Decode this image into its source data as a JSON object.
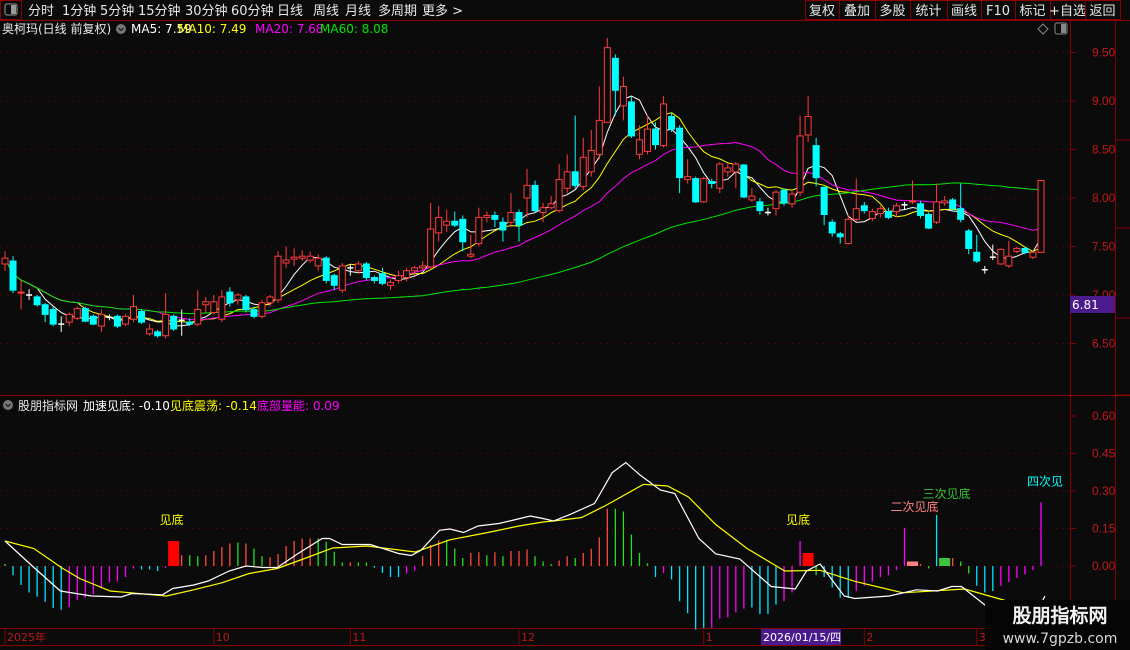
{
  "toolbar": {
    "periods": [
      "分时",
      "1分钟",
      "5分钟",
      "15分钟",
      "30分钟",
      "60分钟",
      "日线",
      "周线",
      "月线",
      "多周期",
      "更多 >"
    ],
    "active_period": "日线",
    "buttons": [
      "复权",
      "叠加",
      "多股",
      "统计",
      "画线",
      "F10",
      "标记",
      "+自选",
      "返回"
    ]
  },
  "main_chart": {
    "title": "奥柯玛(日线 前复权)",
    "ma": [
      {
        "label": "MA5: 7.59",
        "color": "#ffffff"
      },
      {
        "label": "MA10: 7.49",
        "color": "#ffff00"
      },
      {
        "label": "MA20: 7.68",
        "color": "#ff00ff"
      },
      {
        "label": "MA60: 8.08",
        "color": "#00e600"
      }
    ],
    "y_ticks": [
      "9.50",
      "9.00",
      "8.50",
      "8.00",
      "7.50",
      "7.00",
      "6.50"
    ],
    "y_tick_values": [
      9.5,
      9.0,
      8.5,
      8.0,
      7.5,
      7.0,
      6.5
    ],
    "cursor_price": "6.81",
    "up_color": "#ff3c3c",
    "down_color": "#00ffff",
    "candles": [
      [
        7.32,
        7.38,
        7.45,
        7.25
      ],
      [
        7.35,
        7.05,
        7.4,
        7.02
      ],
      [
        7.02,
        7.03,
        7.15,
        6.85
      ],
      [
        7.0,
        7.0,
        7.06,
        6.95
      ],
      [
        6.98,
        6.9,
        7.0,
        6.88
      ],
      [
        6.9,
        6.8,
        6.92,
        6.72
      ],
      [
        6.85,
        6.7,
        6.88,
        6.68
      ],
      [
        6.7,
        6.7,
        6.78,
        6.62
      ],
      [
        6.72,
        6.8,
        6.82,
        6.68
      ],
      [
        6.76,
        6.86,
        6.88,
        6.74
      ],
      [
        6.86,
        6.73,
        6.88,
        6.72
      ],
      [
        6.78,
        6.7,
        6.8,
        6.69
      ],
      [
        6.68,
        6.8,
        6.85,
        6.62
      ],
      [
        6.77,
        6.77,
        6.8,
        6.74
      ],
      [
        6.78,
        6.68,
        6.8,
        6.66
      ],
      [
        6.7,
        6.78,
        6.8,
        6.68
      ],
      [
        6.75,
        6.88,
        7.0,
        6.72
      ],
      [
        6.83,
        6.72,
        6.85,
        6.7
      ],
      [
        6.6,
        6.65,
        6.7,
        6.58
      ],
      [
        6.62,
        6.58,
        6.64,
        6.56
      ],
      [
        6.58,
        6.8,
        7.02,
        6.55
      ],
      [
        6.78,
        6.65,
        6.8,
        6.63
      ],
      [
        6.74,
        6.74,
        6.85,
        6.58
      ],
      [
        6.72,
        6.7,
        6.76,
        6.68
      ],
      [
        6.7,
        6.85,
        7.05,
        6.68
      ],
      [
        6.9,
        6.93,
        6.98,
        6.82
      ],
      [
        6.82,
        6.93,
        7.0,
        6.8
      ],
      [
        6.75,
        6.98,
        7.05,
        6.72
      ],
      [
        7.03,
        6.92,
        7.08,
        6.88
      ],
      [
        6.95,
        7.0,
        7.02,
        6.9
      ],
      [
        6.98,
        6.85,
        7.0,
        6.82
      ],
      [
        6.85,
        6.78,
        6.88,
        6.76
      ],
      [
        6.78,
        6.92,
        6.95,
        6.76
      ],
      [
        6.92,
        6.98,
        7.0,
        6.88
      ],
      [
        6.95,
        7.4,
        7.45,
        6.92
      ],
      [
        7.33,
        7.36,
        7.5,
        7.28
      ],
      [
        7.37,
        7.39,
        7.48,
        7.3
      ],
      [
        7.38,
        7.4,
        7.46,
        7.35
      ],
      [
        7.36,
        7.4,
        7.45,
        7.33
      ],
      [
        7.3,
        7.38,
        7.42,
        7.25
      ],
      [
        7.38,
        7.15,
        7.4,
        7.12
      ],
      [
        7.2,
        7.1,
        7.22,
        7.05
      ],
      [
        7.05,
        7.3,
        7.33,
        7.02
      ],
      [
        7.28,
        7.28,
        7.32,
        7.2
      ],
      [
        7.25,
        7.32,
        7.35,
        7.22
      ],
      [
        7.32,
        7.18,
        7.34,
        7.15
      ],
      [
        7.18,
        7.15,
        7.2,
        7.12
      ],
      [
        7.22,
        7.12,
        7.28,
        7.1
      ],
      [
        7.1,
        7.13,
        7.16,
        7.05
      ],
      [
        7.15,
        7.2,
        7.25,
        7.12
      ],
      [
        7.18,
        7.25,
        7.28,
        7.14
      ],
      [
        7.25,
        7.28,
        7.3,
        7.2
      ],
      [
        7.28,
        7.3,
        7.35,
        7.26
      ],
      [
        7.29,
        7.68,
        7.95,
        7.27
      ],
      [
        7.64,
        7.8,
        7.92,
        7.55
      ],
      [
        7.72,
        7.76,
        7.88,
        7.65
      ],
      [
        7.76,
        7.72,
        7.86,
        7.7
      ],
      [
        7.78,
        7.55,
        7.82,
        7.45
      ],
      [
        7.4,
        7.42,
        7.62,
        7.38
      ],
      [
        7.53,
        7.8,
        7.9,
        7.5
      ],
      [
        7.8,
        7.82,
        7.86,
        7.75
      ],
      [
        7.82,
        7.78,
        7.86,
        7.7
      ],
      [
        7.75,
        7.67,
        7.8,
        7.55
      ],
      [
        7.75,
        7.85,
        8.05,
        7.7
      ],
      [
        7.85,
        7.72,
        7.88,
        7.55
      ],
      [
        8.0,
        8.13,
        8.3,
        7.8
      ],
      [
        8.13,
        7.87,
        8.18,
        7.85
      ],
      [
        7.85,
        7.9,
        7.95,
        7.75
      ],
      [
        7.9,
        7.94,
        8.02,
        7.88
      ],
      [
        7.87,
        8.19,
        8.35,
        7.85
      ],
      [
        8.1,
        8.27,
        8.45,
        8.05
      ],
      [
        8.27,
        8.13,
        8.85,
        8.1
      ],
      [
        8.12,
        8.42,
        8.62,
        8.08
      ],
      [
        8.27,
        8.49,
        8.7,
        8.22
      ],
      [
        8.45,
        8.8,
        9.15,
        8.4
      ],
      [
        8.78,
        9.55,
        9.65,
        8.78
      ],
      [
        9.44,
        9.11,
        9.48,
        8.85
      ],
      [
        8.95,
        9.15,
        9.25,
        8.8
      ],
      [
        8.99,
        8.64,
        9.05,
        8.62
      ],
      [
        8.45,
        8.6,
        8.75,
        8.4
      ],
      [
        8.48,
        8.71,
        8.85,
        8.45
      ],
      [
        8.71,
        8.55,
        8.78,
        8.5
      ],
      [
        8.54,
        8.97,
        9.05,
        8.52
      ],
      [
        8.84,
        8.71,
        8.88,
        8.68
      ],
      [
        8.72,
        8.21,
        8.75,
        8.05
      ],
      [
        8.19,
        8.22,
        8.4,
        8.15
      ],
      [
        8.2,
        7.96,
        8.22,
        7.95
      ],
      [
        7.96,
        8.2,
        8.22,
        7.95
      ],
      [
        8.17,
        8.15,
        8.2,
        8.1
      ],
      [
        8.1,
        8.35,
        8.37,
        8.05
      ],
      [
        8.27,
        8.31,
        8.36,
        8.22
      ],
      [
        8.27,
        8.35,
        8.37,
        8.1
      ],
      [
        8.34,
        8.01,
        8.35,
        8.0
      ],
      [
        7.98,
        8.02,
        8.1,
        7.96
      ],
      [
        7.96,
        7.87,
        8.0,
        7.83
      ],
      [
        7.85,
        7.85,
        7.9,
        7.82
      ],
      [
        7.89,
        8.06,
        8.08,
        7.82
      ],
      [
        8.08,
        7.95,
        8.1,
        7.92
      ],
      [
        7.94,
        8.04,
        8.07,
        7.9
      ],
      [
        8.06,
        8.64,
        8.85,
        8.02
      ],
      [
        8.65,
        8.84,
        9.05,
        8.58
      ],
      [
        8.54,
        8.21,
        8.62,
        8.12
      ],
      [
        8.11,
        7.83,
        8.12,
        7.72
      ],
      [
        7.75,
        7.64,
        7.78,
        7.6
      ],
      [
        7.63,
        7.6,
        7.65,
        7.53
      ],
      [
        7.53,
        7.78,
        7.83,
        7.52
      ],
      [
        7.78,
        7.89,
        8.2,
        7.76
      ],
      [
        7.92,
        7.87,
        7.96,
        7.84
      ],
      [
        7.79,
        7.86,
        7.89,
        7.76
      ],
      [
        7.84,
        7.89,
        7.92,
        7.8
      ],
      [
        7.86,
        7.8,
        7.9,
        7.78
      ],
      [
        7.86,
        7.92,
        7.95,
        7.8
      ],
      [
        7.93,
        7.93,
        7.96,
        7.88
      ],
      [
        7.96,
        7.97,
        8.18,
        7.94
      ],
      [
        7.94,
        7.82,
        7.97,
        7.79
      ],
      [
        7.83,
        7.69,
        7.85,
        7.68
      ],
      [
        7.75,
        7.96,
        8.15,
        7.73
      ],
      [
        7.95,
        7.97,
        8.02,
        7.92
      ],
      [
        7.98,
        7.89,
        8.0,
        7.86
      ],
      [
        7.89,
        7.78,
        8.15,
        7.75
      ],
      [
        7.66,
        7.48,
        7.68,
        7.42
      ],
      [
        7.44,
        7.35,
        7.62,
        7.33
      ],
      [
        7.26,
        7.26,
        7.3,
        7.22
      ],
      [
        7.39,
        7.39,
        7.52,
        7.36
      ],
      [
        7.32,
        7.47,
        7.48,
        7.31
      ],
      [
        7.3,
        7.4,
        7.56,
        7.28
      ],
      [
        7.45,
        7.48,
        7.5,
        7.43
      ],
      [
        7.48,
        7.44,
        7.5,
        7.42
      ],
      [
        7.39,
        7.44,
        7.46,
        7.37
      ],
      [
        7.44,
        8.18,
        8.18,
        7.44
      ]
    ]
  },
  "indicator": {
    "name": "股朋指标网",
    "legend": [
      {
        "label": "加速见底: -0.10",
        "color": "#ffffff"
      },
      {
        "label": "见底震荡: -0.14",
        "color": "#ffff00"
      },
      {
        "label": "底部量能: 0.09",
        "color": "#ff00ff"
      }
    ],
    "y_ticks": [
      "0.60",
      "0.45",
      "0.30",
      "0.15",
      "0.00"
    ],
    "y_tick_values": [
      0.6,
      0.45,
      0.3,
      0.15,
      0.0
    ],
    "hist": [
      0.008,
      -0.037,
      -0.076,
      -0.106,
      -0.123,
      -0.143,
      -0.168,
      -0.175,
      -0.164,
      -0.137,
      -0.127,
      -0.113,
      -0.09,
      -0.065,
      -0.062,
      -0.044,
      -0.01,
      -0.014,
      -0.014,
      -0.02,
      -0.007,
      0.1,
      0.043,
      0.043,
      0.039,
      0.043,
      0.06,
      0.076,
      0.09,
      0.094,
      0.09,
      0.07,
      0.039,
      0.035,
      0.048,
      0.08,
      0.1,
      0.11,
      0.11,
      0.11,
      0.097,
      0.057,
      0.014,
      0.014,
      0.014,
      0.014,
      -0.007,
      -0.028,
      -0.044,
      -0.044,
      -0.03,
      -0.018,
      0.039,
      0.084,
      0.103,
      0.105,
      0.07,
      0.032,
      0.052,
      0.055,
      0.043,
      0.055,
      0.039,
      0.06,
      0.06,
      0.066,
      0.039,
      0.018,
      0.007,
      0.022,
      0.039,
      0.032,
      0.052,
      0.069,
      0.114,
      0.229,
      0.229,
      0.218,
      0.126,
      0.052,
      0.011,
      -0.044,
      -0.028,
      -0.054,
      -0.141,
      -0.189,
      -0.254,
      -0.248,
      -0.248,
      -0.21,
      -0.206,
      -0.186,
      -0.171,
      -0.166,
      -0.192,
      -0.192,
      -0.154,
      -0.141,
      -0.106,
      0.1,
      0.052,
      -0.037,
      -0.044,
      -0.086,
      -0.127,
      -0.127,
      -0.1,
      -0.079,
      -0.062,
      -0.044,
      -0.037,
      -0.017,
      0.153,
      0.018,
      0.008,
      -0.01,
      0.204,
      0.032,
      0.032,
      0.018,
      -0.03,
      -0.079,
      -0.106,
      -0.1,
      -0.079,
      -0.065,
      -0.048,
      -0.034,
      -0.017,
      0.255
    ],
    "hist_colors": "gcccccccmmmmmmmmmcccmRrggrrrrgrggrrrrrrggggrggccccmmrrrgggrrgrgrrrgggrrgrrrrgggggcmcccccmmmmmccccmmmRgccccmmmmmmmPrgcGrggcccmmmmmmC",
    "color_map": {
      "c": "#00e5ff",
      "m": "#ff00ff",
      "r": "#ff4a3a",
      "g": "#22e022",
      "R": "#ff0000",
      "P": "#ff8080",
      "G": "#3cc43c",
      "C": "#00ffff"
    },
    "signals": [
      {
        "index": 21,
        "label": "见底",
        "color": "#ffff00"
      },
      {
        "index": 99,
        "label": "见底",
        "color": "#ffff00"
      },
      {
        "index": 112,
        "label": "二次见底",
        "color": "#ff8080"
      },
      {
        "index": 116,
        "label": "三次见底",
        "color": "#3cc43c"
      },
      {
        "index": 129,
        "label": "四次见",
        "color": "#00ffff"
      }
    ],
    "white_line": [
      [
        0,
        0.1
      ],
      [
        3.6,
        -0.006
      ],
      [
        6.9,
        -0.1
      ],
      [
        10.8,
        -0.12
      ],
      [
        14.5,
        -0.124
      ],
      [
        15.8,
        -0.11
      ],
      [
        19.6,
        -0.115
      ],
      [
        20.9,
        -0.09
      ],
      [
        23.5,
        -0.076
      ],
      [
        25.3,
        -0.06
      ],
      [
        27.9,
        -0.02
      ],
      [
        30,
        0.0
      ],
      [
        32.1,
        -0.006
      ],
      [
        33.9,
        -0.006
      ],
      [
        36.5,
        0.05
      ],
      [
        39.5,
        0.11
      ],
      [
        40.4,
        0.11
      ],
      [
        42,
        0.086
      ],
      [
        45.5,
        0.086
      ],
      [
        49,
        0.05
      ],
      [
        50.6,
        0.042
      ],
      [
        51.8,
        0.063
      ],
      [
        54.1,
        0.143
      ],
      [
        55.4,
        0.148
      ],
      [
        57.1,
        0.134
      ],
      [
        58.9,
        0.16
      ],
      [
        61.5,
        0.17
      ],
      [
        63.6,
        0.186
      ],
      [
        65.4,
        0.2
      ],
      [
        67,
        0.19
      ],
      [
        68.3,
        0.18
      ],
      [
        70.4,
        0.207
      ],
      [
        73.4,
        0.25
      ],
      [
        75.6,
        0.373
      ],
      [
        77.3,
        0.414
      ],
      [
        79,
        0.366
      ],
      [
        81.6,
        0.304
      ],
      [
        83.4,
        0.29
      ],
      [
        86.4,
        0.11
      ],
      [
        88.5,
        0.049
      ],
      [
        91.5,
        0.028
      ],
      [
        95.4,
        -0.082
      ],
      [
        98.4,
        -0.092
      ],
      [
        99.8,
        -0.02
      ],
      [
        101.5,
        0.008
      ],
      [
        104.5,
        -0.12
      ],
      [
        105.8,
        -0.13
      ],
      [
        110.1,
        -0.12
      ],
      [
        113.5,
        -0.095
      ],
      [
        116.1,
        -0.1
      ],
      [
        117.9,
        -0.082
      ],
      [
        119.1,
        -0.082
      ],
      [
        122.1,
        -0.158
      ],
      [
        124.4,
        -0.17
      ],
      [
        126.3,
        -0.18
      ],
      null,
      [
        129,
        -0.15
      ],
      [
        129.5,
        -0.12
      ]
    ],
    "yellow_line": [
      [
        0,
        0.1
      ],
      [
        3.6,
        0.07
      ],
      [
        7.1,
        -0.008
      ],
      [
        9.3,
        -0.05
      ],
      [
        13.1,
        -0.1
      ],
      [
        16.6,
        -0.11
      ],
      [
        20.1,
        -0.12
      ],
      [
        23.5,
        -0.095
      ],
      [
        27,
        -0.067
      ],
      [
        30.4,
        -0.03
      ],
      [
        33.9,
        -0.01
      ],
      [
        37.3,
        0.03
      ],
      [
        40.8,
        0.072
      ],
      [
        45.1,
        0.08
      ],
      [
        51.1,
        0.056
      ],
      [
        55.4,
        0.105
      ],
      [
        59.8,
        0.132
      ],
      [
        64,
        0.16
      ],
      [
        67,
        0.176
      ],
      [
        68.3,
        0.18
      ],
      [
        71.8,
        0.194
      ],
      [
        74.8,
        0.242
      ],
      [
        79.5,
        0.327
      ],
      [
        82.5,
        0.32
      ],
      [
        85.1,
        0.276
      ],
      [
        88.5,
        0.166
      ],
      [
        92.4,
        0.07
      ],
      [
        97.1,
        -0.02
      ],
      [
        101.5,
        -0.017
      ],
      [
        105.8,
        -0.061
      ],
      [
        111.8,
        -0.107
      ],
      [
        119.5,
        -0.092
      ],
      [
        123,
        -0.124
      ],
      [
        126.5,
        -0.155
      ],
      [
        129,
        -0.17
      ]
    ]
  },
  "x_axis": {
    "labels": [
      {
        "text": "2025年",
        "index": 0
      },
      {
        "text": "10",
        "index": 26
      },
      {
        "text": "11",
        "index": 43
      },
      {
        "text": "12",
        "index": 64
      },
      {
        "text": "1",
        "index": 87
      },
      {
        "text": "2",
        "index": 107
      },
      {
        "text": "3",
        "index": 121
      }
    ],
    "cursor_date": "2026/01/15/四"
  },
  "watermark": {
    "title": "股朋指标网",
    "url": "www.7gpzb.com"
  }
}
